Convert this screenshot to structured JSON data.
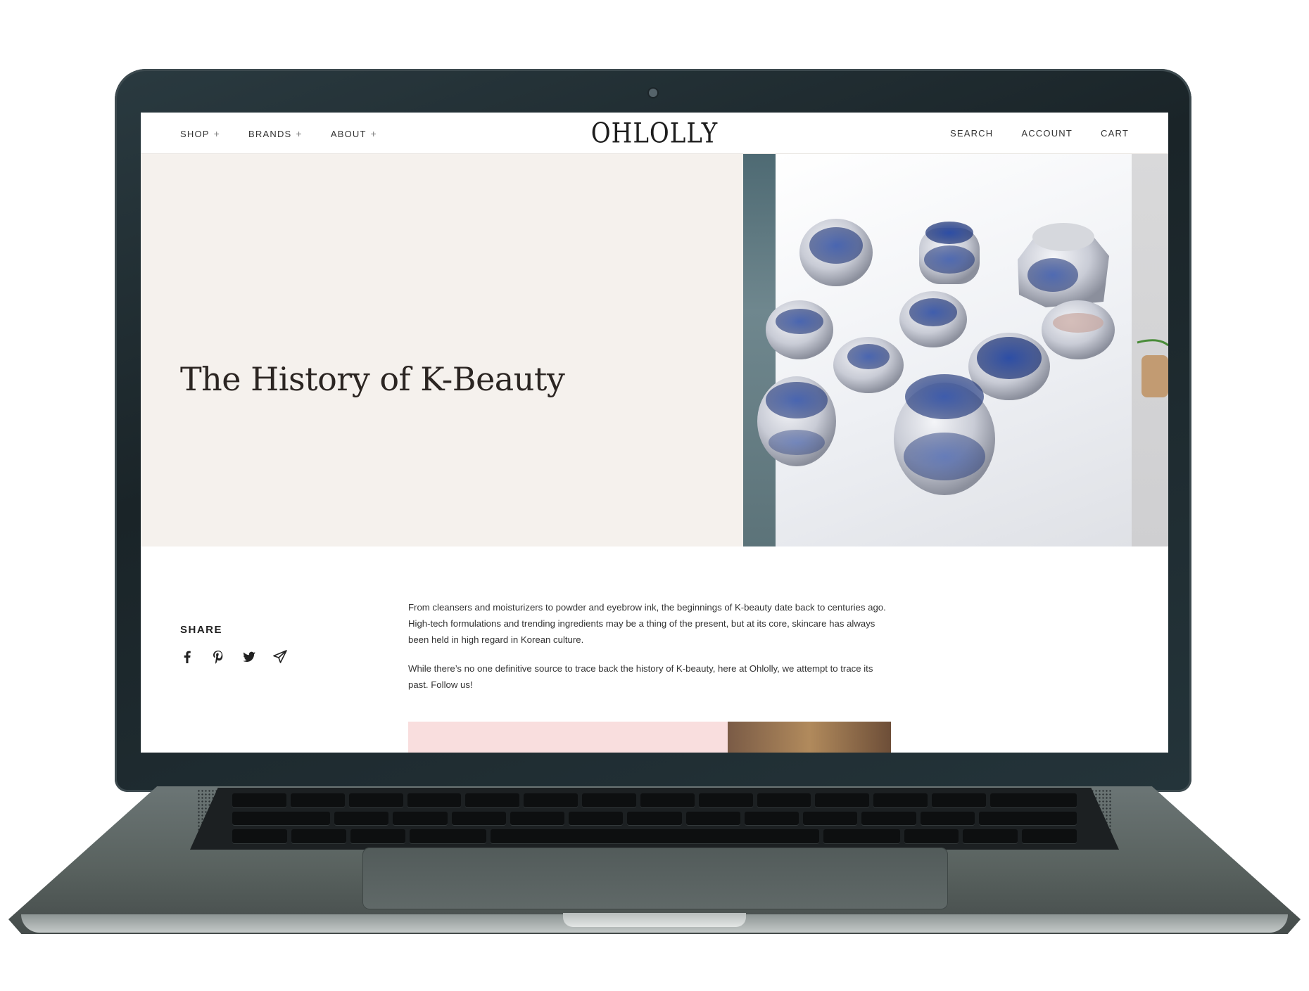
{
  "nav": {
    "left": [
      {
        "label": "SHOP",
        "suffix": "+"
      },
      {
        "label": "BRANDS",
        "suffix": "+"
      },
      {
        "label": "ABOUT",
        "suffix": "+"
      }
    ],
    "logo": "OHLOLLY",
    "right": [
      "SEARCH",
      "ACCOUNT",
      "CART"
    ]
  },
  "hero": {
    "title": "The History of K-Beauty",
    "image_icon": "blue-white-porcelain-jars-image"
  },
  "share": {
    "label": "SHARE",
    "icons": [
      "facebook-icon",
      "pinterest-icon",
      "twitter-icon",
      "send-icon"
    ]
  },
  "article": {
    "paragraphs": [
      "From cleansers and moisturizers to powder and eyebrow ink, the beginnings of K-beauty date back to centuries ago. High-tech formulations and trending ingredients may be a thing of the present, but at its core, skincare has always been held in high regard in Korean culture.",
      "While there’s no one definitive source to trace back the history of K-beauty, here at Ohlolly, we attempt to trace its past. Follow us!"
    ]
  },
  "colors": {
    "hero_bg": "#f5f1ed",
    "text": "#2b2522",
    "article_block_pink": "#f9dede",
    "porcelain_blue": "#2a4a9a"
  }
}
